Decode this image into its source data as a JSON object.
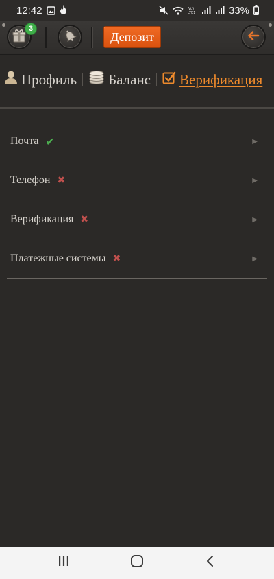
{
  "status_bar": {
    "time": "12:42",
    "battery": "33%",
    "icons": [
      "image-icon",
      "flame-icon",
      "mute-icon",
      "wifi-icon",
      "volte-icon",
      "signal-icon",
      "signal-icon-2",
      "battery-icon"
    ]
  },
  "top_bar": {
    "gift_badge": "3",
    "deposit_label": "Депозит"
  },
  "tabs": [
    {
      "label": "Профиль",
      "icon": "user-icon"
    },
    {
      "label": "Баланс",
      "icon": "coins-icon"
    },
    {
      "label": "Верификация",
      "icon": "checkbox-icon",
      "active": true
    }
  ],
  "verification_items": [
    {
      "label": "Почта",
      "status": "ok"
    },
    {
      "label": "Телефон",
      "status": "missing"
    },
    {
      "label": "Верификация",
      "status": "missing"
    },
    {
      "label": "Платежные системы",
      "status": "missing"
    }
  ],
  "colors": {
    "accent": "#ee8a2c",
    "deposit_button": "#e25f18",
    "ok": "#4caf50",
    "missing": "#c0504d",
    "background": "#2b2927",
    "badge": "#3fae49"
  }
}
